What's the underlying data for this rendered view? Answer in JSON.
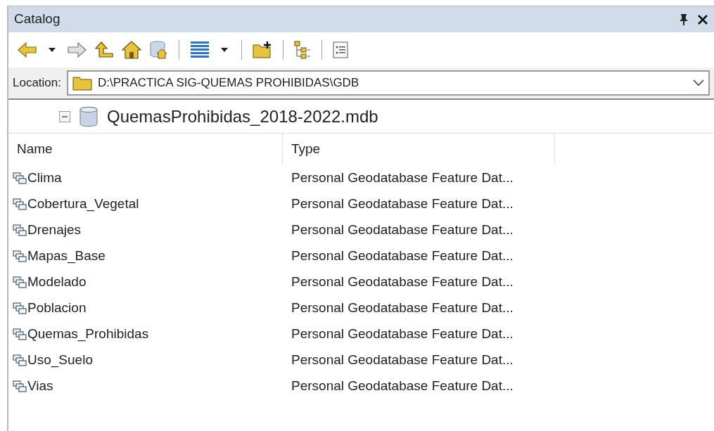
{
  "window": {
    "title": "Catalog"
  },
  "location": {
    "label": "Location:",
    "value": "D:\\PRACTICA SIG-QUEMAS PROHIBIDAS\\GDB"
  },
  "tree": {
    "expanded": true,
    "label": "QuemasProhibidas_2018-2022.mdb"
  },
  "table": {
    "columns": [
      "Name",
      "Type"
    ],
    "rows": [
      {
        "name": "Clima",
        "type": "Personal Geodatabase Feature Dat..."
      },
      {
        "name": "Cobertura_Vegetal",
        "type": "Personal Geodatabase Feature Dat..."
      },
      {
        "name": "Drenajes",
        "type": "Personal Geodatabase Feature Dat..."
      },
      {
        "name": "Mapas_Base",
        "type": "Personal Geodatabase Feature Dat..."
      },
      {
        "name": "Modelado",
        "type": "Personal Geodatabase Feature Dat..."
      },
      {
        "name": "Poblacion",
        "type": "Personal Geodatabase Feature Dat..."
      },
      {
        "name": "Quemas_Prohibidas",
        "type": "Personal Geodatabase Feature Dat..."
      },
      {
        "name": "Uso_Suelo",
        "type": "Personal Geodatabase Feature Dat..."
      },
      {
        "name": "Vias",
        "type": "Personal Geodatabase Feature Dat..."
      }
    ]
  }
}
